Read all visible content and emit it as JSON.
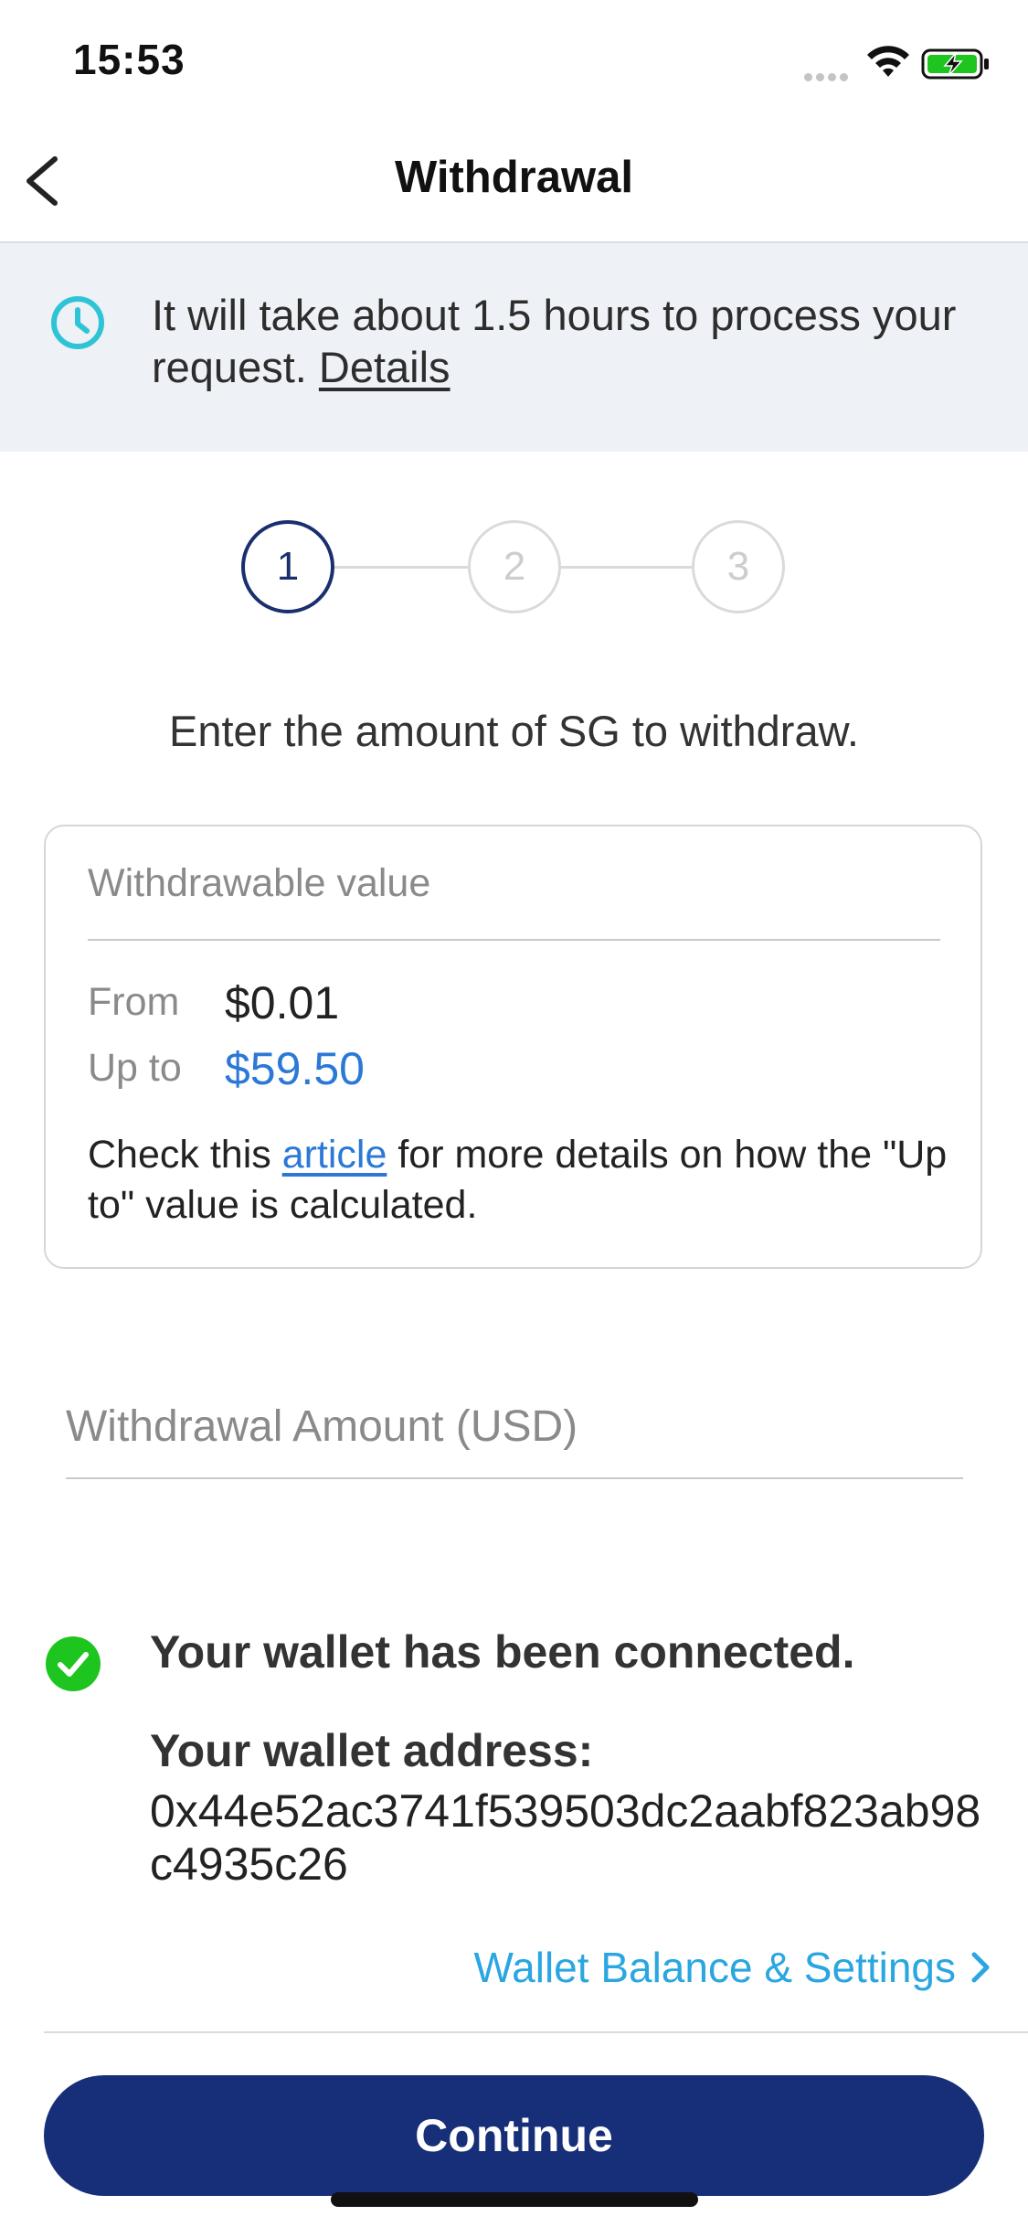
{
  "status_bar": {
    "time": "15:53"
  },
  "nav": {
    "title": "Withdrawal"
  },
  "banner": {
    "message": "It will take about 1.5 hours to process your request.",
    "link_label": "Details"
  },
  "stepper": {
    "steps": [
      "1",
      "2",
      "3"
    ],
    "active_step": 1
  },
  "instruction": "Enter the amount of SG to withdraw.",
  "withdrawable_card": {
    "title": "Withdrawable value",
    "from_label": "From",
    "from_value": "$0.01",
    "upto_label": "Up to",
    "upto_value": "$59.50",
    "note_prefix": "Check this",
    "note_link": "article",
    "note_suffix": "for more details on how the \"Up to\" value is calculated."
  },
  "amount_field": {
    "placeholder": "Withdrawal Amount (USD)",
    "value": ""
  },
  "wallet": {
    "status": "Your wallet has been connected.",
    "address_label": "Your wallet address:",
    "address": "0x44e52ac3741f539503dc2aabf823ab98c4935c26",
    "settings_link": "Wallet Balance & Settings"
  },
  "continue_label": "Continue",
  "colors": {
    "primary": "#172f78",
    "accent_blue": "#2b78d6",
    "link_cyan": "#2aa6e0",
    "clock_teal": "#2ec4d6",
    "success_green": "#1ec51e",
    "banner_bg": "#eef1f5"
  },
  "icons": [
    "back-icon",
    "clock-icon",
    "check-circle-icon",
    "chevron-right-icon",
    "wifi-icon",
    "battery-charging-icon"
  ]
}
